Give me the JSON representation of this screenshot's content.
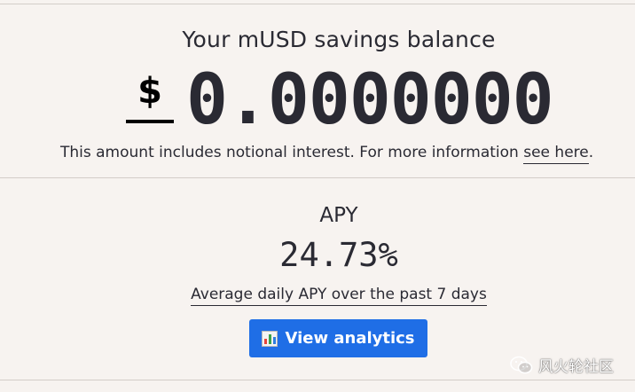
{
  "balance": {
    "title": "Your mUSD savings balance",
    "currency_symbol": "$",
    "amount": "0.0000000",
    "note_text": "This amount includes notional interest. For more information ",
    "note_link": "see here",
    "note_end": "."
  },
  "apy": {
    "label": "APY",
    "value": "24.73%",
    "description": "Average daily APY over the past 7 days",
    "button_label": "View analytics",
    "button_icon": "bar-chart-icon"
  },
  "watermark": {
    "text": "风火轮社区",
    "icon": "wechat-icon"
  },
  "colors": {
    "background": "#f7f3f0",
    "text": "#2a2a33",
    "button": "#1f6ee6",
    "divider": "#d3cdc8"
  }
}
